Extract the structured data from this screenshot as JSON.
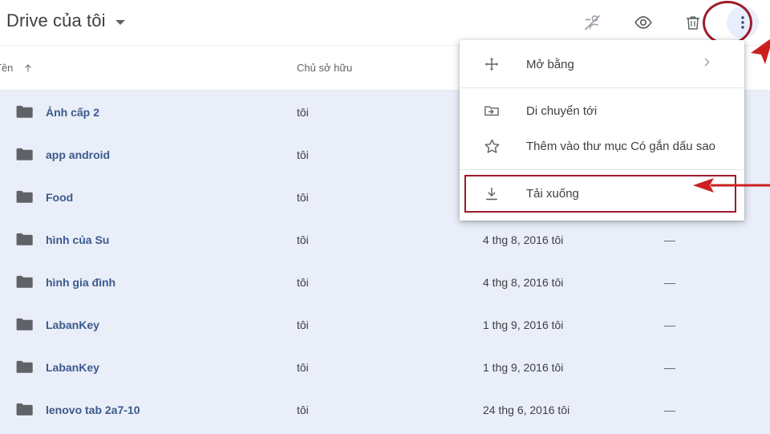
{
  "topbar": {
    "title": "Drive của tôi",
    "dropdown_icon": "caret-down-icon",
    "actions": [
      {
        "name": "remove-person-icon",
        "label": "Xóa người dùng"
      },
      {
        "name": "preview-eye-icon",
        "label": "Xem trước"
      },
      {
        "name": "trash-icon",
        "label": "Xóa"
      },
      {
        "name": "more-vert-icon",
        "label": "Thêm tùy chọn"
      }
    ]
  },
  "columns": {
    "name": "Tên",
    "sort_icon": "arrow-up-icon",
    "owner": "Chủ sở hữu",
    "modified": "",
    "size": ""
  },
  "files": [
    {
      "name": "Ảnh cấp 2",
      "owner": "tôi",
      "modified": "",
      "size": ""
    },
    {
      "name": "app android",
      "owner": "tôi",
      "modified": "",
      "size": ""
    },
    {
      "name": "Food",
      "owner": "tôi",
      "modified": "",
      "size": ""
    },
    {
      "name": "hình của Su",
      "owner": "tôi",
      "modified": "4 thg 8, 2016 tôi",
      "size": "—"
    },
    {
      "name": "hình gia đình",
      "owner": "tôi",
      "modified": "4 thg 8, 2016 tôi",
      "size": "—"
    },
    {
      "name": "LabanKey",
      "owner": "tôi",
      "modified": "1 thg 9, 2016 tôi",
      "size": "—"
    },
    {
      "name": "LabanKey",
      "owner": "tôi",
      "modified": "1 thg 9, 2016 tôi",
      "size": "—"
    },
    {
      "name": "lenovo tab 2a7-10",
      "owner": "tôi",
      "modified": "24 thg 6, 2016 tôi",
      "size": "—"
    }
  ],
  "menu": {
    "items": [
      {
        "label": "Mở bằng",
        "icon": "move-arrows-icon",
        "has_submenu": true
      },
      {
        "label": "Di chuyển tới",
        "icon": "move-to-folder-icon",
        "has_submenu": false
      },
      {
        "label": "Thêm vào thư mục Có gắn dấu sao",
        "icon": "star-outline-icon",
        "has_submenu": false
      },
      {
        "label": "Tải xuống",
        "icon": "download-icon",
        "has_submenu": false,
        "highlighted": true
      }
    ]
  },
  "annotations": {
    "circle_color": "#9c1b2c",
    "arrow_color": "#cc1f1f",
    "highlight_color": "#9c1b2c"
  },
  "colors": {
    "row_background": "#e9eef9",
    "file_name_color": "#3c5a8c",
    "surface": "#ffffff",
    "accent_button_bg": "#e8eefc"
  }
}
